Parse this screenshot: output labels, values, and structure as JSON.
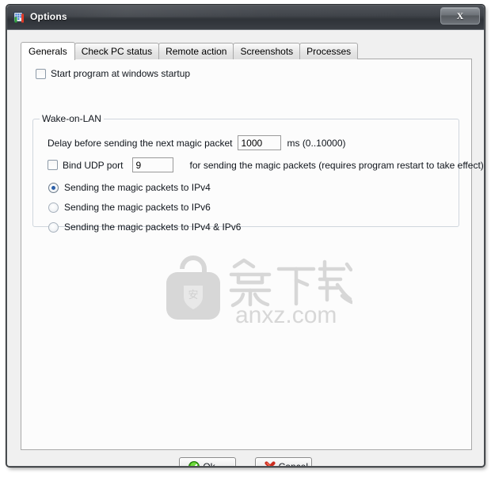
{
  "window": {
    "title": "Options",
    "icon": "options-app-icon",
    "close_label": "X"
  },
  "tabs": [
    {
      "label": "Generals",
      "active": true
    },
    {
      "label": "Check PC status",
      "active": false
    },
    {
      "label": "Remote action",
      "active": false
    },
    {
      "label": "Screenshots",
      "active": false
    },
    {
      "label": "Processes",
      "active": false
    }
  ],
  "generals": {
    "startup": {
      "label": "Start program at windows startup",
      "checked": false
    },
    "wake_on_lan": {
      "legend": "Wake-on-LAN",
      "delay": {
        "label": "Delay before sending the next magic packet",
        "value": "1000",
        "unit_label": "ms  (0..10000)"
      },
      "bind_port": {
        "label": "Bind UDP port",
        "checked": false,
        "value": "9",
        "suffix_label": "for sending the magic packets (requires program restart to take effect)"
      },
      "target_options": [
        {
          "label": "Sending the magic packets to IPv4",
          "selected": true
        },
        {
          "label": "Sending the magic packets to IPv6",
          "selected": false
        },
        {
          "label": "Sending the magic packets to IPv4 & IPv6",
          "selected": false
        }
      ]
    }
  },
  "watermark": {
    "cn_text": "安下载",
    "badge_text": "安",
    "site": "anxz.com",
    "color": "#d7d7d7"
  },
  "footer": {
    "ok_label": "Ok",
    "cancel_label": "Cancel"
  },
  "colors": {
    "titlebar_dark": "#3f4349",
    "accent_blue": "#2b5fa8",
    "ok_green": "#3aa510",
    "cancel_red": "#cc2b1e",
    "panel_bg": "#fcfcfc",
    "dialog_bg": "#f0f0f0"
  }
}
